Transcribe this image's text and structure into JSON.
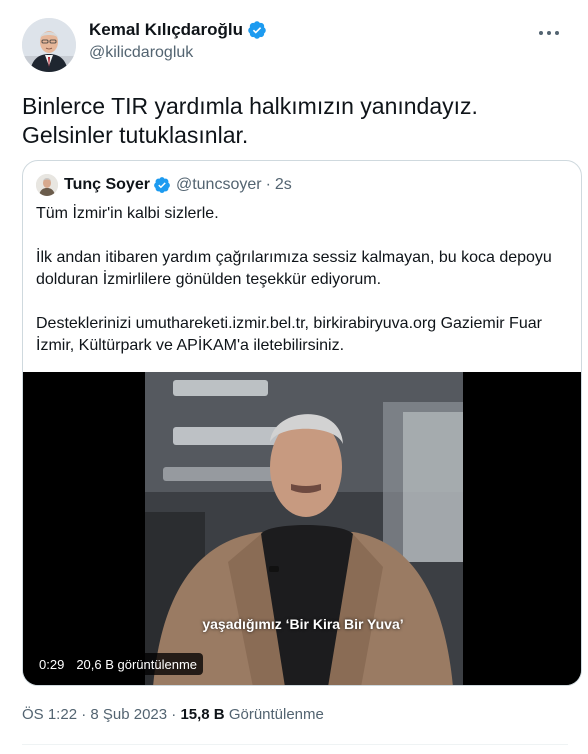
{
  "author": {
    "name": "Kemal Kılıçdaroğlu",
    "handle": "@kilicdarogluk",
    "verified_color": "#1d9bf0"
  },
  "tweet": {
    "text": "Binlerce TIR yardımla halkımızın yanındayız. Gelsinler tutuklasınlar."
  },
  "quoted": {
    "name": "Tunç Soyer",
    "handle": "@tuncsoyer",
    "separator": "·",
    "time": "2s",
    "paragraphs": [
      "Tüm İzmir'in kalbi sizlerle.",
      "İlk andan itibaren yardım çağrılarımıza sessiz kalmayan, bu koca depoyu dolduran İzmirlilere gönülden teşekkür ediyorum.",
      "Desteklerinizi umuthareketi.izmir.bel.tr, birkirabiryuva.org Gaziemir Fuar İzmir, Kültürpark ve APİKAM'a iletebilirsiniz."
    ],
    "video": {
      "subtitle": "yaşadığımız ‘Bir Kira Bir Yuva’",
      "duration": "0:29",
      "views": "20,6 B görüntülenme"
    }
  },
  "footer": {
    "time": "ÖS 1:22 · 8 Şub 2023 ·",
    "views_count": "15,8 B",
    "views_label": "Görüntülenme"
  }
}
